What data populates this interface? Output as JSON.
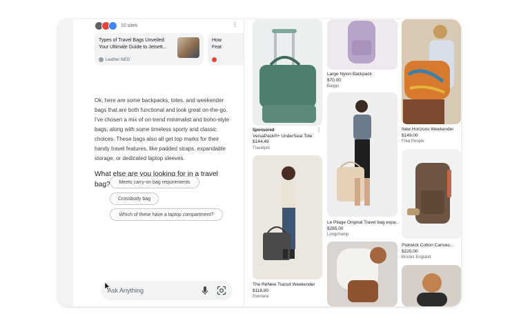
{
  "sources": {
    "count_label": "10 sites",
    "cards": [
      {
        "title": "Types of Travel Bags Unveiled: Your Ultimate Guide to Jetsett...",
        "site": "Leather NEO"
      },
      {
        "title": "How Feat",
        "site": ""
      }
    ]
  },
  "answer_text": "Ok, here are some backpacks, totes, and weekender bags that are both functional and look great on-the-go. I've chosen a mix of on-trend minimalist and boho-style bags, along with some timeless sporty and classic choices. These bags also all get top marks for their handy travel features, like padded straps, expandable storage, or dedicated laptop sleeves.",
  "followup_question": "What else are you looking for in a travel bag?",
  "suggestions": [
    "Meets carry-on bag requirements",
    "Crossbody bag",
    "Which of these have a laptop compartment?"
  ],
  "ask": {
    "placeholder": "Ask Anything",
    "icons": [
      "mic-icon",
      "lens-icon"
    ]
  },
  "products": {
    "col1": [
      {
        "sponsored": "Sponsored",
        "title": "VersaPack®+ UnderSeat Tote",
        "price": "$144.49",
        "store": "Travelpro"
      },
      {
        "title": "The ReNew Transit Weekender",
        "price": "$118.00",
        "store": "Everlane"
      }
    ],
    "col2": [
      {
        "title": "Large Nylon Backpack",
        "price": "$70.00",
        "store": "Baggu"
      },
      {
        "title": "Le Pliage Original Travel bag expa...",
        "price": "$285.00",
        "store": "Longchamp"
      }
    ],
    "col3": [
      {
        "title": "New Horizons Weekender",
        "price": "$149.00",
        "store": "Free People"
      },
      {
        "title": "Pickwick Cotton Canvas...",
        "price": "$220.00",
        "store": "Brooks England"
      }
    ]
  },
  "colors": {
    "accent": "#1a73e8",
    "chip_border": "#c4c7c5",
    "surface": "#f1f3f4"
  }
}
